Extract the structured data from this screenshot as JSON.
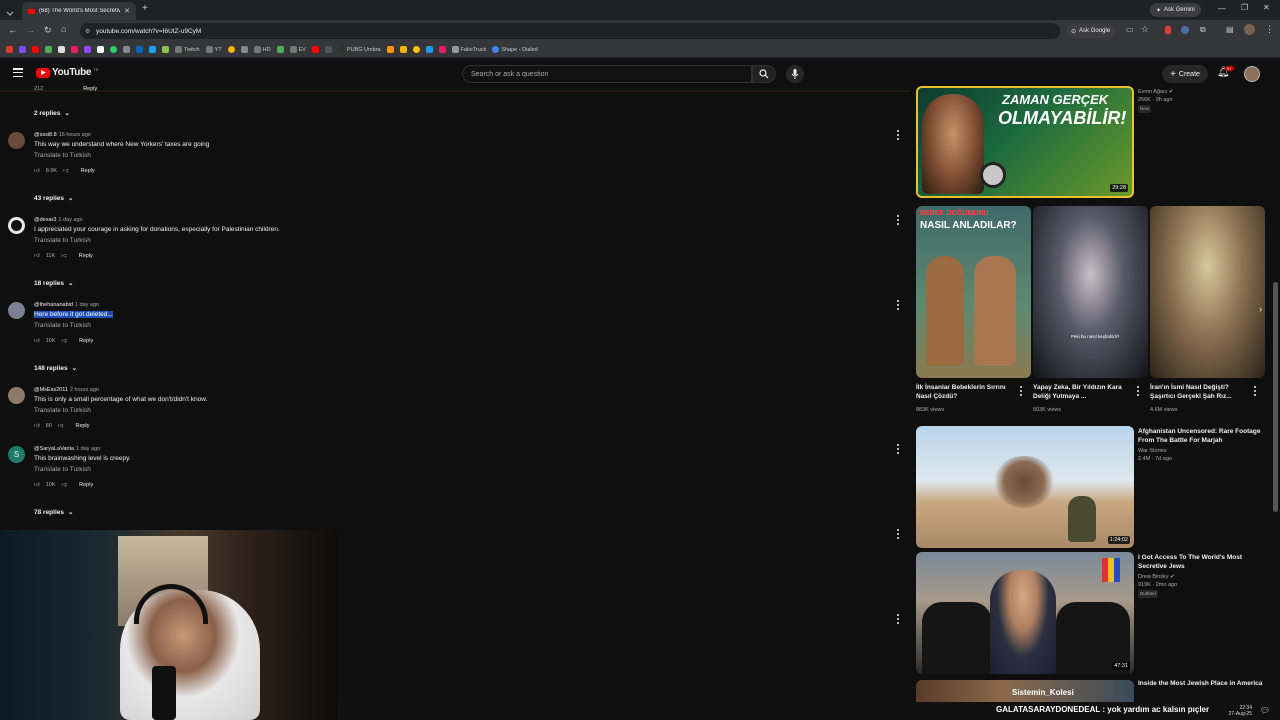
{
  "browser": {
    "tab_title": "(68) The World's Most Secretive...",
    "url": "youtube.com/watch?v=I6UtZ-u9CyM",
    "ask_gemini": "Ask Gemini",
    "ask_google": "Ask Google",
    "bookmarks": [
      "Twitch",
      "YT",
      "HD",
      "EV",
      "PUBG Umbra",
      "FakeTruck",
      "Shape - Dialed"
    ]
  },
  "youtube": {
    "logo_text": "YouTube",
    "logo_region": "TR",
    "search_placeholder": "Search or ask a question",
    "create_label": "Create",
    "notif_count": "9+"
  },
  "top_fragment": {
    "likes": "212",
    "reply": "Reply"
  },
  "comments": [
    {
      "replies_above": "2 replies",
      "user": "@sssi8.8",
      "time": "16 hours ago",
      "text": "This way we understand where New Yorkers' taxes are going",
      "translate": "Translate to Turkish",
      "likes": "8.9K",
      "reply": "Reply",
      "replies": "43 replies",
      "avatar_color": "#6a4a3a"
    },
    {
      "user": "@dexar3",
      "time": "1 day ago",
      "text": "I appreciated your courage in asking for donations, especially for Palestinian children.",
      "translate": "Translate to Turkish",
      "likes": "11K",
      "reply": "Reply",
      "replies": "18 replies",
      "avatar_color": "#e8e8e8"
    },
    {
      "user": "@thehananabid",
      "time": "1 day ago",
      "text_highlight": "Here before it got deleted...",
      "translate": "Translate to Turkish",
      "likes": "16K",
      "reply": "Reply",
      "replies": "148 replies",
      "avatar_color": "#7a8090"
    },
    {
      "user": "@MsEss2011",
      "time": "2 hours ago",
      "text": "This is only a small percentage of what we don't/didn't know.",
      "translate": "Translate to Turkish",
      "likes": "80",
      "reply": "Reply",
      "avatar_color": "#8a7a6a"
    },
    {
      "user": "@SaryaLaVanta",
      "time": "1 day ago",
      "text": "This brainwashing level is creepy.",
      "translate": "Translate to Turkish",
      "likes": "10K",
      "reply": "Reply",
      "replies": "78 replies",
      "avatar_color": "#1e7d6a",
      "avatar_letter": "S"
    }
  ],
  "sidebar": {
    "video1": {
      "thumb_text_1": "ZAMAN GERÇEK",
      "thumb_text_2": "OLMAYABİLİR!",
      "duration": "29:28",
      "channel": "Evrim Ağacı",
      "meta": "256K · 9h ago",
      "badge": "New"
    },
    "shorts": [
      {
        "thumb_text": "NASIL ANLADILAR?",
        "thumb_top": "BEBEK DOĞUMUNU",
        "title": "İlk İnsanlar Bebeklerin Sırrını Nasıl Çözdü?",
        "views": "883K views"
      },
      {
        "thumb_caption": "Peki bu nasıl keşfedildi?",
        "title": "Yapay Zeka, Bir Yıldızın Kara Deliği Yutmaya ...",
        "views": "503K views"
      },
      {
        "title": "İran'ın İsmi Nasıl Değişti? Şaşırtıcı Gerçekl Şah Rız...",
        "views": "4.6M views"
      }
    ],
    "video2": {
      "title": "Afghanistan Uncensored: Rare Footage From The Battle For Marjah",
      "channel": "War Stories",
      "meta": "2.4M · 7d ago",
      "duration": "1:24:02"
    },
    "video3": {
      "title": "I Got Access To The World's Most Secretive Jews",
      "channel": "Drew Binsky",
      "meta": "919K · 2mo ago",
      "badge": "Dubbed",
      "duration": "47:31"
    },
    "video4": {
      "title": "Inside the Most Jewish Place in America",
      "thumb_text": "Sistemin_Kolesi"
    }
  },
  "overlay": {
    "ticker": "GALATASARAYDONEDEAL : yok yardım ac kalsın pıçler",
    "clock": "22:34",
    "date": "27-Aug-25"
  }
}
